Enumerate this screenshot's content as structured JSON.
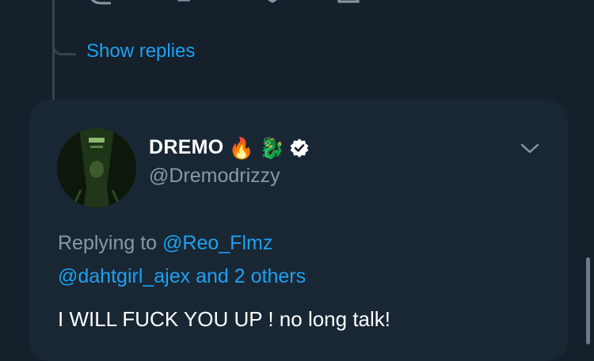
{
  "thread": {
    "show_replies_label": "Show replies"
  },
  "tweet": {
    "display_name": "DREMO",
    "emojis": [
      "🔥",
      "🐉"
    ],
    "verified": true,
    "handle": "@Dremodrizzy",
    "replying_prefix": "Replying to",
    "reply_to_primary": "@Reo_Flmz",
    "reply_to_secondary": "@dahtgirl_ajex and 2 others",
    "text": "I WILL FUCK YOU UP ! no long talk!"
  },
  "colors": {
    "background": "#15202b",
    "card": "#192734",
    "accent": "#1da1f2",
    "muted": "#8899a6"
  }
}
